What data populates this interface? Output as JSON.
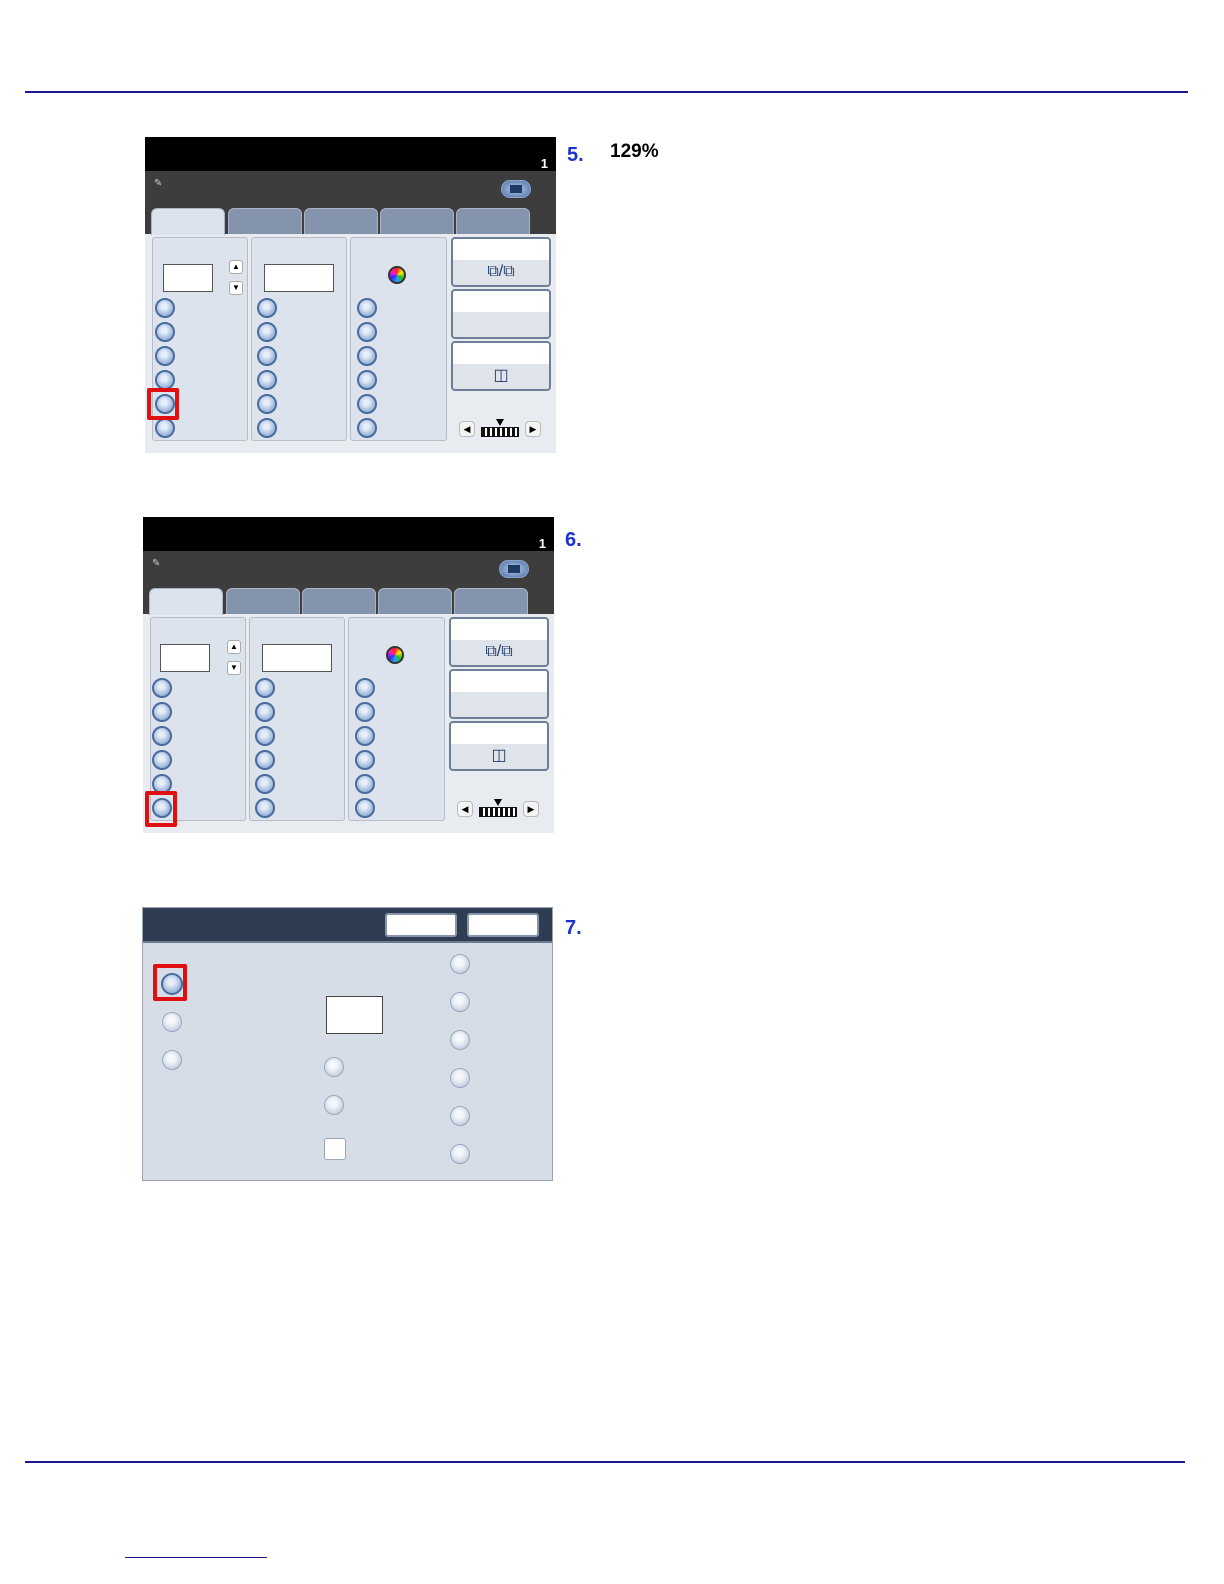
{
  "steps": [
    {
      "number": "5.",
      "text": "129%"
    },
    {
      "number": "6.",
      "text": ""
    },
    {
      "number": "7.",
      "text": ""
    }
  ],
  "copy_screen": {
    "counter": "1"
  }
}
